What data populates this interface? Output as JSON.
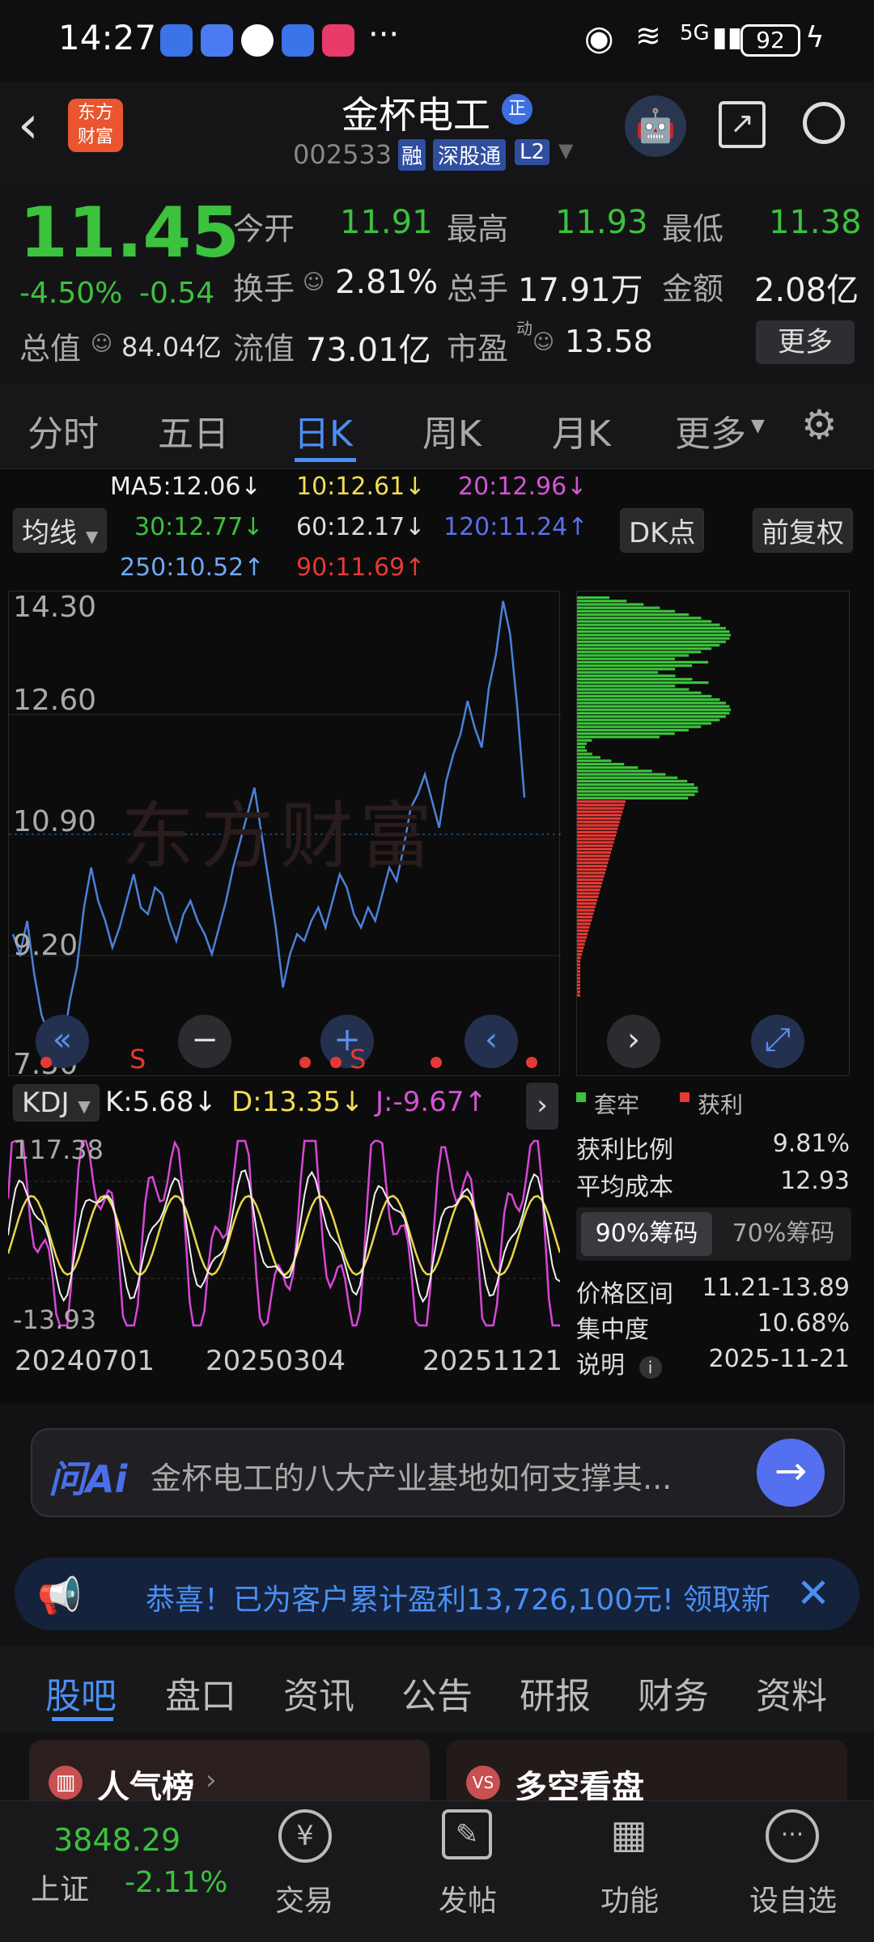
{
  "status_bar": {
    "time": "14:27",
    "battery": "92",
    "signal": "5G"
  },
  "header": {
    "back_icon": "chevron-left-icon",
    "logo_text_1": "东方",
    "logo_text_2": "财富",
    "stock_name": "金杯电工",
    "badge_zheng": "正",
    "stock_code": "002533",
    "tag_rong": "融",
    "tag_shengu": "深股通",
    "tag_l2": "L2"
  },
  "quote": {
    "price": "11.45",
    "change_pct": "-4.50%",
    "change": "-0.54",
    "open_label": "今开",
    "open": "11.91",
    "high_label": "最高",
    "high": "11.93",
    "low_label": "最低",
    "low": "11.38",
    "turnover_label": "换手",
    "turnover": "2.81%",
    "volume_label": "总手",
    "volume": "17.91万",
    "amount_label": "金额",
    "amount": "2.08亿",
    "mcap_label": "总值",
    "mcap": "84.04亿",
    "float_label": "流值",
    "float": "73.01亿",
    "pe_label": "市盈",
    "pe_sup": "动",
    "pe": "13.58",
    "more_label": "更多"
  },
  "chart_tabs": [
    "分时",
    "五日",
    "日K",
    "周K",
    "月K",
    "更多"
  ],
  "ma": {
    "button": "均线",
    "ma5": "MA5:12.06↓",
    "ma10": "10:12.61↓",
    "ma20": "20:12.96↓",
    "ma30": "30:12.77↓",
    "ma60": "60:12.17↓",
    "ma120": "120:11.24↑",
    "ma250": "250:10.52↑",
    "ma90": "90:11.69↑",
    "dk_label": "DK点",
    "fq_label": "前复权"
  },
  "kline": {
    "y_ticks": [
      "14.30",
      "12.60",
      "10.90",
      "9.20",
      "7.50"
    ],
    "watermark": "东方财富",
    "series": [
      9.4,
      9.1,
      9.6,
      8.8,
      8.2,
      7.9,
      8.1,
      7.7,
      8.4,
      8.9,
      9.8,
      10.4,
      9.9,
      9.6,
      9.2,
      9.5,
      9.9,
      10.3,
      9.8,
      9.7,
      10.1,
      10.0,
      9.6,
      9.3,
      9.7,
      9.9,
      9.6,
      9.4,
      9.1,
      9.5,
      9.9,
      10.4,
      10.8,
      11.2,
      11.6,
      10.9,
      10.2,
      9.5,
      8.6,
      9.1,
      9.4,
      9.3,
      9.6,
      9.8,
      9.5,
      9.9,
      10.3,
      10.1,
      9.7,
      9.5,
      9.8,
      9.6,
      10.0,
      10.4,
      10.2,
      10.7,
      11.3,
      11.5,
      11.8,
      11.4,
      11.0,
      11.7,
      12.1,
      12.4,
      12.9,
      12.5,
      12.2,
      13.1,
      13.6,
      14.4,
      13.9,
      12.8,
      11.45
    ],
    "chip_labels": [
      "套牢",
      "获利"
    ]
  },
  "kdj": {
    "label": "KDJ",
    "k": "K:5.68↓",
    "d": "D:13.35↓",
    "j": "J:-9.67↑",
    "y_top": "117.38",
    "y_bottom": "-13.93",
    "dates": [
      "20240701",
      "20250304",
      "20251121"
    ]
  },
  "chip_info": {
    "profit_ratio_label": "获利比例",
    "profit_ratio": "9.81%",
    "avg_cost_label": "平均成本",
    "avg_cost": "12.93",
    "tab90": "90%筹码",
    "tab70": "70%筹码",
    "range_label": "价格区间",
    "range": "11.21-13.89",
    "concentration_label": "集中度",
    "concentration": "10.68%",
    "note_label": "说明",
    "date": "2025-11-21"
  },
  "ai": {
    "logo": "问Ai",
    "prompt": "金杯电工的八大产业基地如何支撑其..."
  },
  "notice": {
    "text": "恭喜！已为客户累计盈利13,726,100元! 领取新"
  },
  "bottom_tabs": [
    "股吧",
    "盘口",
    "资讯",
    "公告",
    "研报",
    "财务",
    "资料"
  ],
  "cards": {
    "left": "人气榜",
    "right": "多空看盘"
  },
  "bottom_nav": {
    "index_value": "3848.29",
    "index_name": "上证",
    "index_change": "-2.11%",
    "trade": "交易",
    "post": "发帖",
    "func": "功能",
    "watch": "设自选"
  },
  "colors": {
    "up": "#e53935",
    "down": "#3cc23c",
    "accent": "#4a8ff5"
  }
}
